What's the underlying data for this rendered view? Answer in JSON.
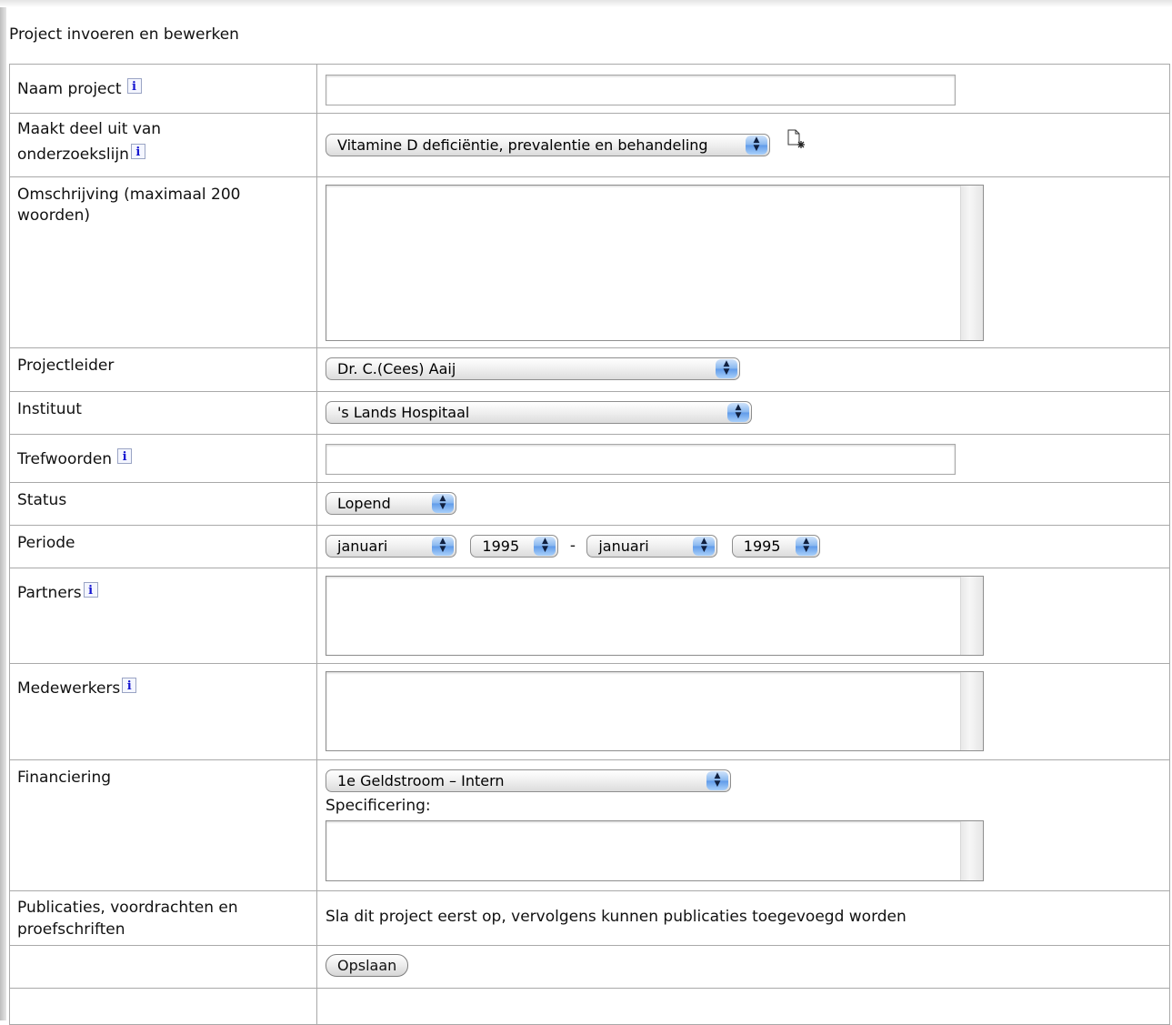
{
  "page": {
    "title": "Project invoeren en bewerken"
  },
  "form": {
    "naam_project": {
      "label": "Naam project",
      "value": ""
    },
    "onderzoekslijn": {
      "label_line1": "Maakt deel uit van",
      "label_line2": "onderzoekslijn",
      "selected": "Vitamine D deficiëntie, prevalentie en behandeling"
    },
    "omschrijving": {
      "label": "Omschrijving (maximaal 200 woorden)",
      "value": ""
    },
    "projectleider": {
      "label": "Projectleider",
      "selected": "Dr. C.(Cees) Aaij"
    },
    "instituut": {
      "label": "Instituut",
      "selected": "'s Lands Hospitaal"
    },
    "trefwoorden": {
      "label": "Trefwoorden",
      "value": ""
    },
    "status": {
      "label": "Status",
      "selected": "Lopend"
    },
    "periode": {
      "label": "Periode",
      "start_month": "januari",
      "start_year": "1995",
      "separator": "-",
      "end_month": "januari",
      "end_year": "1995"
    },
    "partners": {
      "label": "Partners",
      "value": ""
    },
    "medewerkers": {
      "label": "Medewerkers",
      "value": ""
    },
    "financiering": {
      "label": "Financiering",
      "selected": "1e Geldstroom – Intern",
      "spec_label": "Specificering:",
      "spec_value": ""
    },
    "publicaties": {
      "label": "Publicaties, voordrachten en proefschriften",
      "note": "Sla dit project eerst op, vervolgens kunnen publicaties toegevoegd worden"
    },
    "save_label": "Opslaan"
  },
  "icons": {
    "info": "i",
    "select_arrows": "▲▼"
  }
}
